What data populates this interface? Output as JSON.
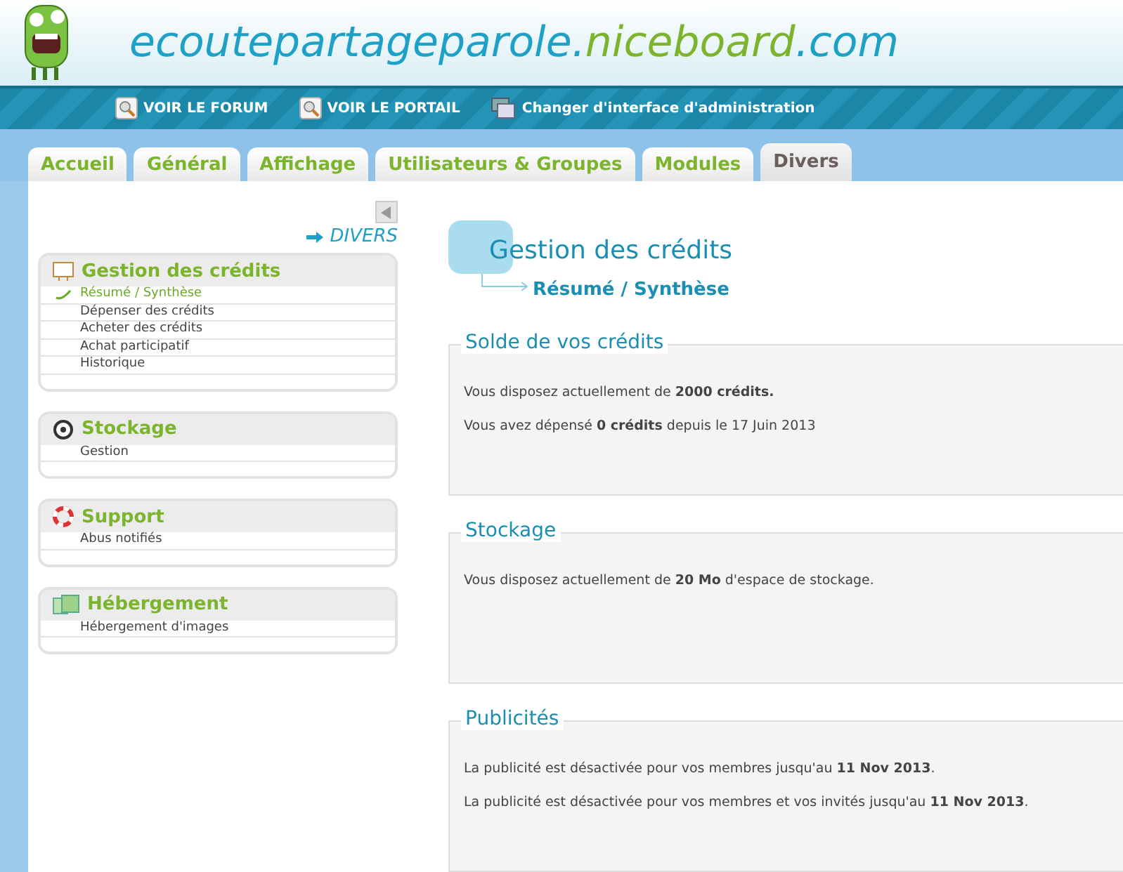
{
  "site_title": [
    {
      "text": "ecoutepartageparole.",
      "highlight": false
    },
    {
      "text": "niceboard",
      "highlight": true
    },
    {
      "text": ".com",
      "highlight": false
    }
  ],
  "nav_links": [
    {
      "label": "VOIR LE FORUM",
      "kind": "view"
    },
    {
      "label": "VOIR LE PORTAIL",
      "kind": "view"
    },
    {
      "label": "Changer d'interface d'administration",
      "kind": "switch"
    }
  ],
  "tabs": [
    {
      "label": "Accueil",
      "selected": false
    },
    {
      "label": "Général",
      "selected": false
    },
    {
      "label": "Affichage",
      "selected": false
    },
    {
      "label": "Utilisateurs & Groupes",
      "selected": false
    },
    {
      "label": "Modules",
      "selected": false
    },
    {
      "label": "Divers",
      "selected": true
    }
  ],
  "sidebar": {
    "section_label": "DIVERS",
    "groups": [
      {
        "title": "Gestion des crédits",
        "kind": "credits",
        "items": [
          {
            "label": "Résumé / Synthèse",
            "selected": true
          },
          {
            "label": "Dépenser des crédits",
            "selected": false
          },
          {
            "label": "Acheter des crédits",
            "selected": false
          },
          {
            "label": "Achat participatif",
            "selected": false
          },
          {
            "label": "Historique",
            "selected": false
          }
        ]
      },
      {
        "title": "Stockage",
        "kind": "storage",
        "items": [
          {
            "label": "Gestion",
            "selected": false
          }
        ]
      },
      {
        "title": "Support",
        "kind": "support",
        "items": [
          {
            "label": "Abus notifiés",
            "selected": false
          }
        ]
      },
      {
        "title": "Hébergement",
        "kind": "hosting",
        "items": [
          {
            "label": "Hébergement d'images",
            "selected": false
          }
        ]
      }
    ]
  },
  "page": {
    "title": "Gestion des crédits",
    "subtitle": "Résumé / Synthèse",
    "panels": [
      {
        "title": "Solde de vos crédits",
        "lines": [
          "Vous disposez actuellement de **2000 crédits.**",
          "Vous avez dépensé **0 crédits** depuis le 17 Juin 2013"
        ]
      },
      {
        "title": "Stockage",
        "lines": [
          "Vous disposez actuellement de **20 Mo** d'espace de stockage."
        ]
      },
      {
        "title": "Publicités",
        "lines": [
          "La publicité est désactivée pour vos membres jusqu'au **11 Nov 2013**.",
          "La publicité est désactivée pour vos membres et vos invités jusqu'au **11 Nov 2013**."
        ]
      }
    ]
  }
}
